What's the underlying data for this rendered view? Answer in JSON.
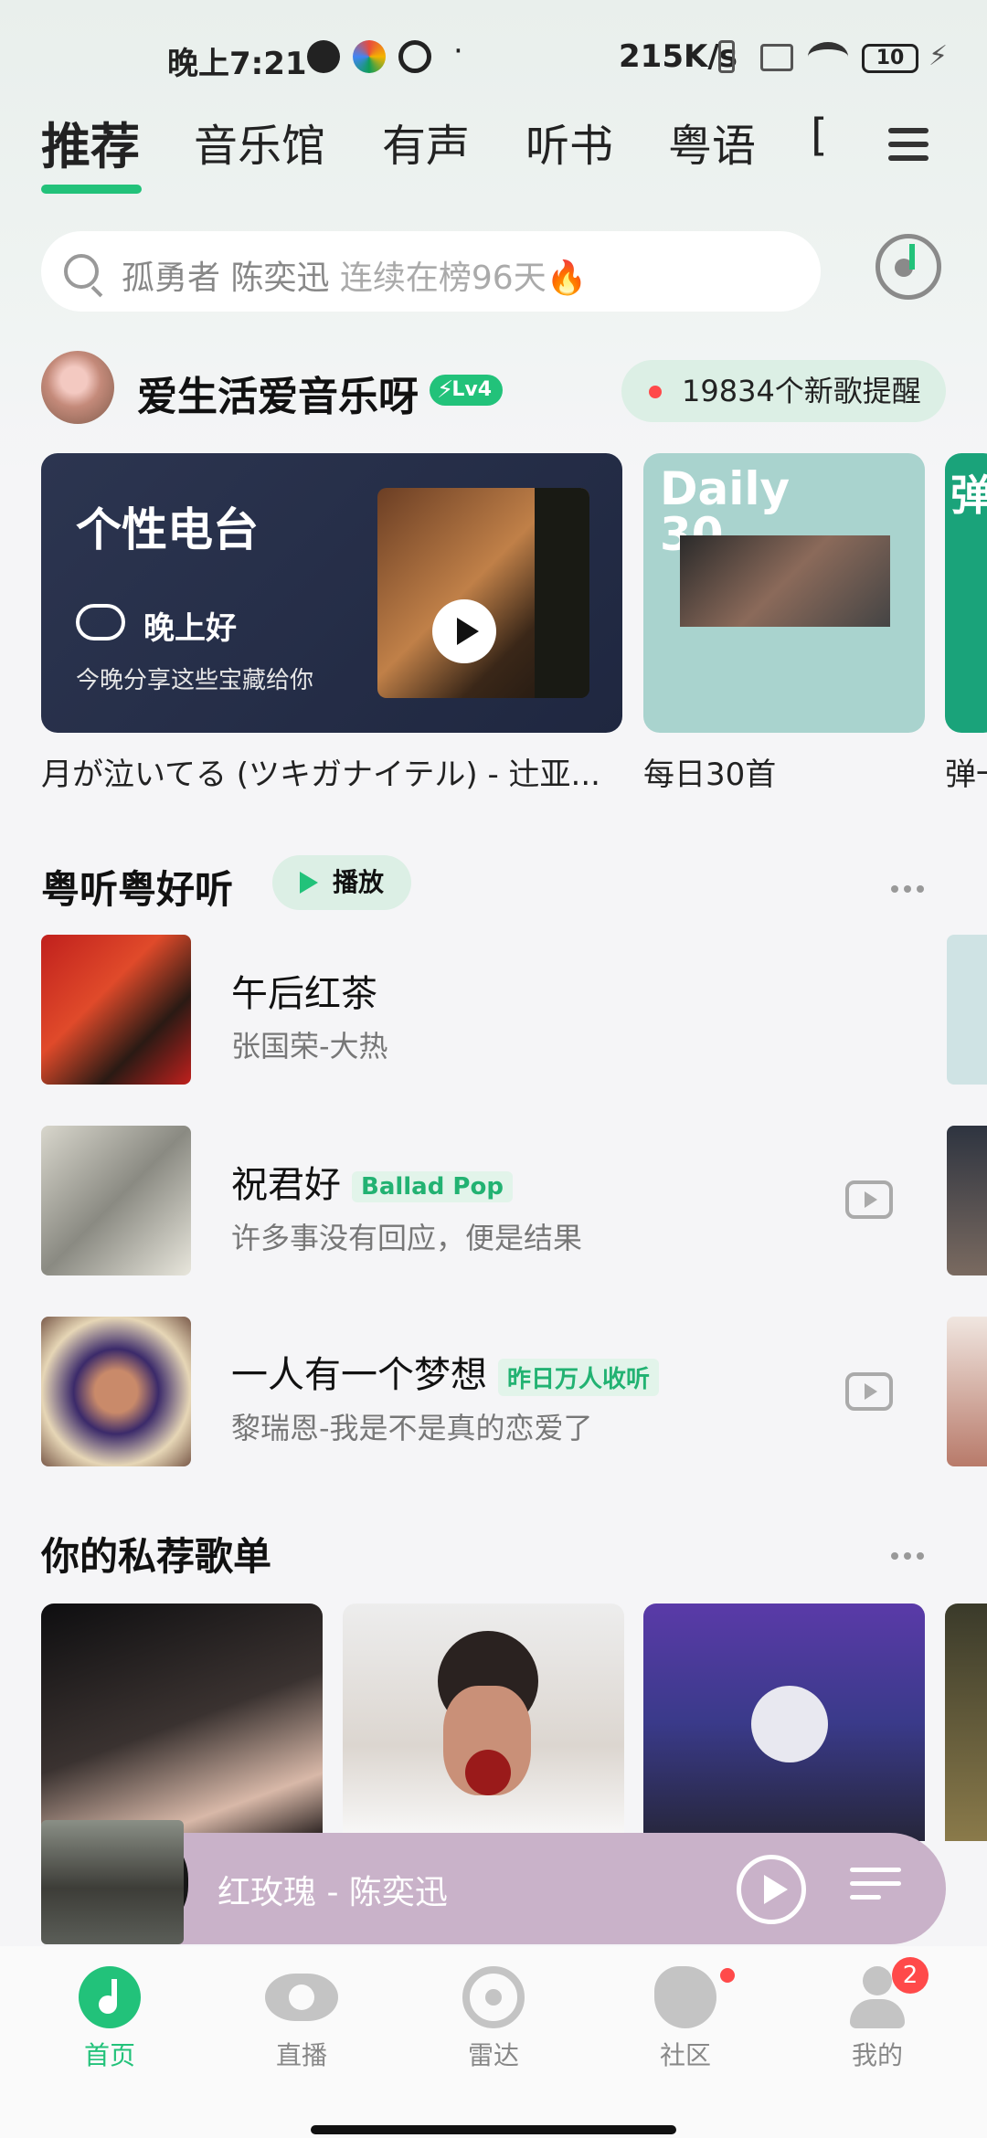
{
  "status_bar": {
    "time": "晚上7:21",
    "net_speed": "215K/s",
    "battery": "10",
    "dot": "·"
  },
  "tabs": [
    "推荐",
    "音乐馆",
    "有声",
    "听书",
    "粤语",
    "["
  ],
  "search": {
    "query": "孤勇者 陈奕迅",
    "hint": "连续在榜96天🔥"
  },
  "user": {
    "name": "爱生活爱音乐呀",
    "level": "Lv4",
    "new_songs": "19834个新歌提醒"
  },
  "cards": {
    "radio": {
      "title": "个性电台",
      "greeting": "晚上好",
      "sub": "今晚分享这些宝藏给你",
      "caption": "月が泣いてる (ツキガナイテル) - 辻亚..."
    },
    "daily": {
      "label_line1": "Daily",
      "label_line2": "30",
      "caption": "每日30首"
    },
    "third": {
      "label": "弹",
      "caption": "弹一"
    }
  },
  "section1": {
    "title": "粤听粤好听",
    "play_label": "播放",
    "songs": [
      {
        "title": "午后红茶",
        "sub": "张国荣-大热",
        "tag": ""
      },
      {
        "title": "祝君好",
        "sub": "许多事没有回应，便是结果",
        "tag": "Ballad Pop"
      },
      {
        "title": "一人有一个梦想",
        "sub": "黎瑞恩-我是不是真的恋爱了",
        "tag": "昨日万人收听"
      }
    ]
  },
  "section2": {
    "title": "你的私荐歌单"
  },
  "mini_player": {
    "title": "红玫瑰 - 陈奕迅"
  },
  "nav": {
    "items": [
      {
        "label": "首页",
        "icon": "home-note-icon"
      },
      {
        "label": "直播",
        "icon": "eye-icon"
      },
      {
        "label": "雷达",
        "icon": "radar-icon"
      },
      {
        "label": "社区",
        "icon": "community-icon"
      },
      {
        "label": "我的",
        "icon": "profile-icon"
      }
    ],
    "profile_badge": "2"
  },
  "colors": {
    "accent": "#22c27a",
    "mini_player": "#c9b2c9",
    "badge": "#ff4a4a"
  }
}
